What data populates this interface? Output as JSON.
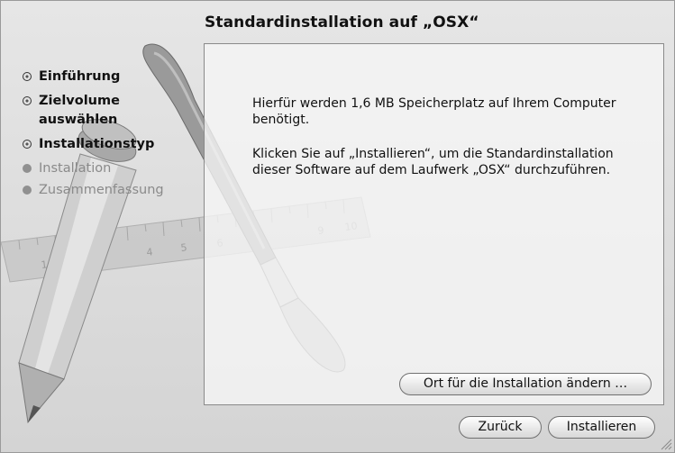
{
  "window": {
    "title": "Standardinstallation auf „OSX“"
  },
  "steps": [
    {
      "label": "Einführung",
      "state": "done"
    },
    {
      "label": "Zielvolume auswählen",
      "state": "done"
    },
    {
      "label": "Installationstyp",
      "state": "current"
    },
    {
      "label": "Installation",
      "state": "pending"
    },
    {
      "label": "Zusammenfassung",
      "state": "pending"
    }
  ],
  "content": {
    "paragraph1": "Hierfür werden 1,6 MB Speicherplatz auf Ihrem Computer benötigt.",
    "paragraph2": "Klicken Sie auf „Installieren“, um die Standardinstallation dieser Software auf dem Laufwerk „OSX“ durchzuführen."
  },
  "buttons": {
    "change_location": "Ort für die Installation ändern …",
    "back": "Zurück",
    "install": "Installieren"
  },
  "background": {
    "ruler_numbers": [
      "1",
      "4",
      "5",
      "6",
      "9",
      "10"
    ]
  }
}
